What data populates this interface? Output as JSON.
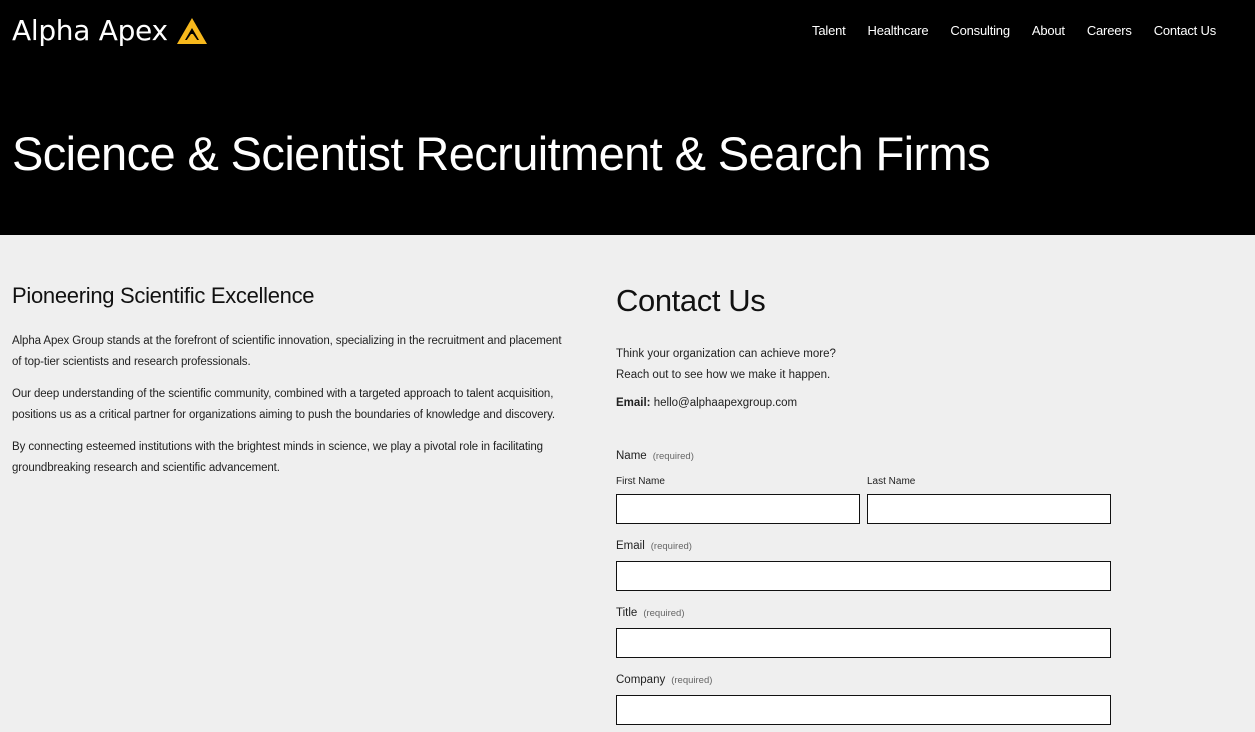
{
  "brand": {
    "name": "Alpha Apex",
    "logo_icon": "triangle-logo-icon",
    "logo_color": "#f7b81c"
  },
  "nav": {
    "items": [
      "Talent",
      "Healthcare",
      "Consulting",
      "About",
      "Careers",
      "Contact Us"
    ]
  },
  "hero": {
    "title": "Science & Scientist Recruitment & Search Firms"
  },
  "about": {
    "heading": "Pioneering Scientific Excellence",
    "paragraphs": [
      "Alpha Apex Group stands at the forefront of scientific innovation, specializing in the recruitment and placement of top-tier scientists and research professionals.",
      "Our deep understanding of the scientific community, combined with a targeted approach to talent acquisition, positions us as a critical partner for organizations aiming to push the boundaries of knowledge and discovery.",
      "By connecting esteemed institutions with the brightest minds in science, we play a pivotal role in facilitating groundbreaking research and scientific advancement."
    ]
  },
  "contact": {
    "heading": "Contact Us",
    "tagline_1": "Think your organization can achieve more?",
    "tagline_2": "Reach out to see how we make it happen.",
    "email_label": "Email:",
    "email_value": "hello@alphaapexgroup.com",
    "form": {
      "required_text": "(required)",
      "name_label": "Name",
      "first_name_label": "First Name",
      "last_name_label": "Last Name",
      "email_label": "Email",
      "title_label": "Title",
      "company_label": "Company",
      "first_name_value": "",
      "last_name_value": "",
      "email_value": "",
      "title_value": "",
      "company_value": ""
    }
  }
}
